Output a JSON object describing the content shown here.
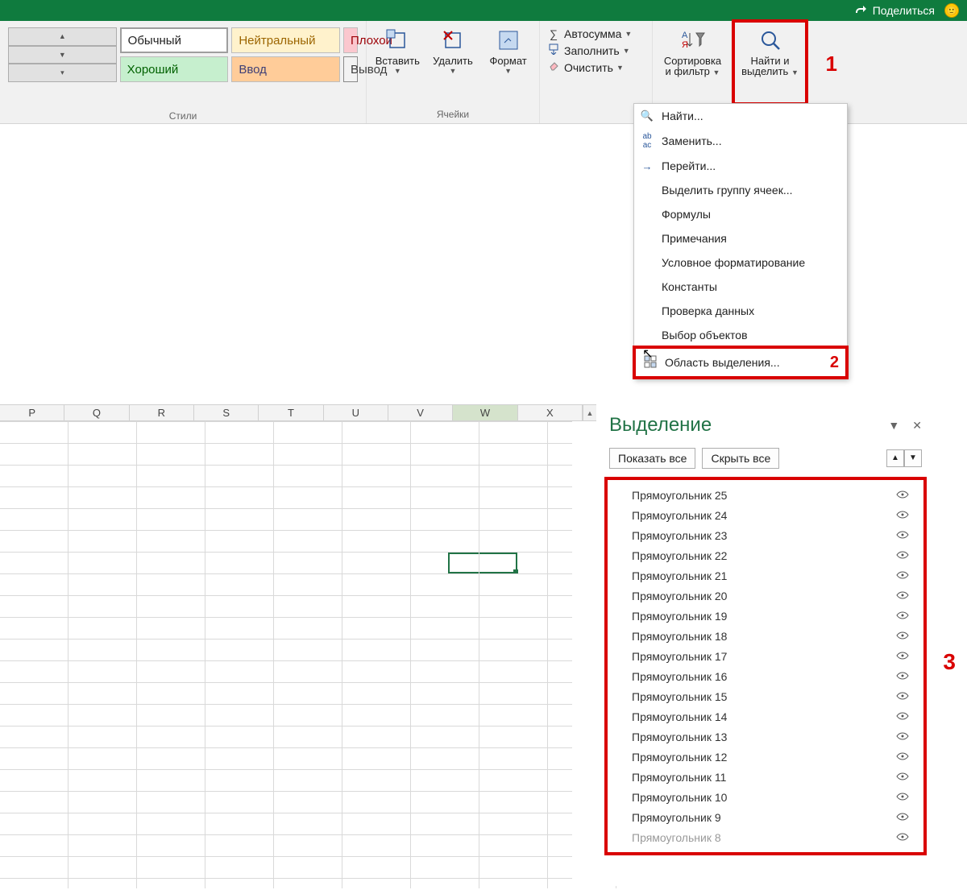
{
  "titlebar": {
    "share": "Поделиться"
  },
  "ribbon": {
    "styles": {
      "label": "Стили",
      "normal": "Обычный",
      "neutral": "Нейтральный",
      "bad": "Плохой",
      "good": "Хороший",
      "input": "Ввод",
      "output": "Вывод"
    },
    "cells": {
      "label": "Ячейки",
      "insert": "Вставить",
      "delete": "Удалить",
      "format": "Формат"
    },
    "editing": {
      "autosum": "Автосумма",
      "fill": "Заполнить",
      "clear": "Очистить"
    },
    "sort": {
      "line1": "Сортировка",
      "line2": "и фильтр"
    },
    "find": {
      "line1": "Найти и",
      "line2": "выделить"
    }
  },
  "callouts": {
    "one": "1",
    "two": "2",
    "three": "3"
  },
  "dropdown": {
    "find": "Найти...",
    "replace": "Заменить...",
    "goto": "Перейти...",
    "gotoSpecial": "Выделить группу ячеек...",
    "formulas": "Формулы",
    "comments": "Примечания",
    "condfmt": "Условное форматирование",
    "constants": "Константы",
    "datavalid": "Проверка данных",
    "selobjects": "Выбор объектов",
    "selpane": "Область выделения..."
  },
  "columns": [
    "P",
    "Q",
    "R",
    "S",
    "T",
    "U",
    "V",
    "W",
    "X"
  ],
  "selectedColumn": "W",
  "pane": {
    "title": "Выделение",
    "showAll": "Показать все",
    "hideAll": "Скрыть все",
    "items": [
      "Прямоугольник 25",
      "Прямоугольник 24",
      "Прямоугольник 23",
      "Прямоугольник 22",
      "Прямоугольник 21",
      "Прямоугольник 20",
      "Прямоугольник 19",
      "Прямоугольник 18",
      "Прямоугольник 17",
      "Прямоугольник 16",
      "Прямоугольник 15",
      "Прямоугольник 14",
      "Прямоугольник 13",
      "Прямоугольник 12",
      "Прямоугольник 11",
      "Прямоугольник 10",
      "Прямоугольник 9",
      "Прямоугольник 8"
    ]
  }
}
